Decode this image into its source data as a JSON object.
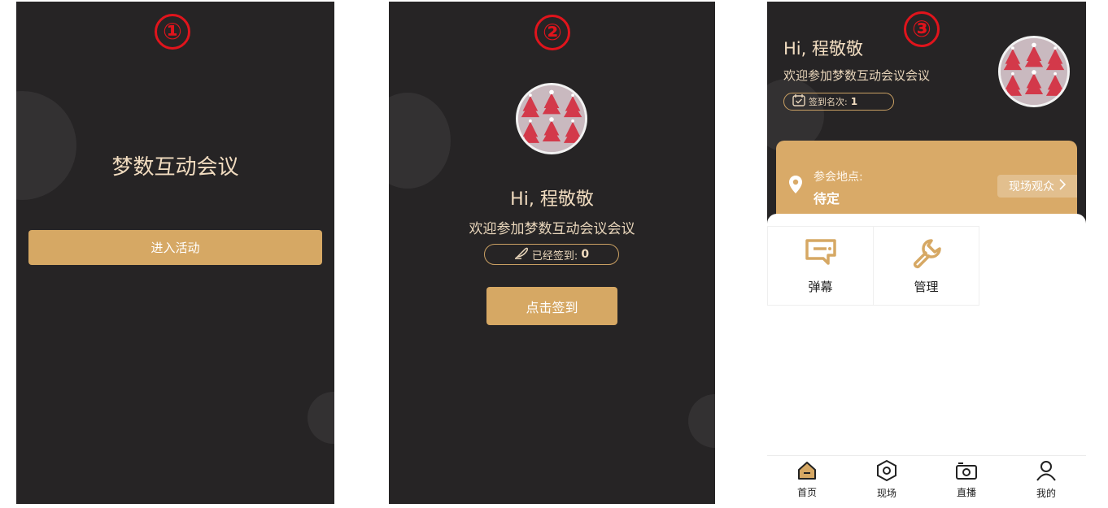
{
  "step_markers": [
    "①",
    "②",
    "③"
  ],
  "screen1": {
    "title": "梦数互动会议",
    "enter_button": "进入活动"
  },
  "screen2": {
    "greeting": "Hi, 程敬敬",
    "welcome": "欢迎参加梦数互动会议会议",
    "signed_label": "已经签到:",
    "signed_count": "0",
    "checkin_button": "点击签到"
  },
  "screen3": {
    "greeting": "Hi, 程敬敬",
    "welcome": "欢迎参加梦数互动会议会议",
    "rank_label": "签到名次:",
    "rank_value": "1",
    "venue_label": "参会地点:",
    "venue_value": "待定",
    "audience_button": "现场观众",
    "grid": [
      {
        "label": "弹幕",
        "icon": "danmaku-icon"
      },
      {
        "label": "管理",
        "icon": "wrench-icon"
      }
    ],
    "tabs": [
      {
        "label": "首页",
        "icon": "home-icon"
      },
      {
        "label": "现场",
        "icon": "hexagon-icon"
      },
      {
        "label": "直播",
        "icon": "camera-icon"
      },
      {
        "label": "我的",
        "icon": "user-icon"
      }
    ]
  },
  "colors": {
    "background": "#262425",
    "gold": "#d6a864",
    "cream_text": "#f1dcc0",
    "marker_red": "#e0141c"
  }
}
